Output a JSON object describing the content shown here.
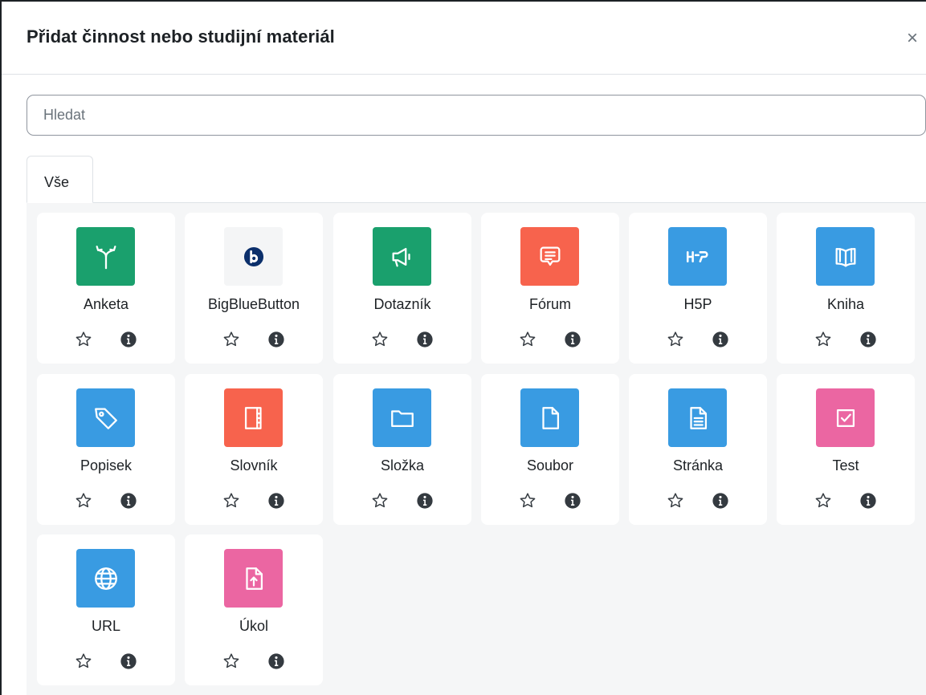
{
  "modal": {
    "title": "Přidat činnost nebo studijní materiál",
    "close_glyph": "×"
  },
  "search": {
    "placeholder": "Hledat",
    "value": ""
  },
  "tabs": [
    {
      "label": "Vše",
      "active": true
    }
  ],
  "colors": {
    "green": "#1aa06d",
    "blue": "#399be2",
    "orange": "#f7634d",
    "pink": "#eb66a2",
    "bbb_bg": "#f4f5f6",
    "bbb_logo": "#0b2f6b"
  },
  "activities": [
    {
      "label": "Anketa",
      "icon": "choice-icon",
      "color": "#1aa06d"
    },
    {
      "label": "BigBlueButton",
      "icon": "bigbluebutton-icon",
      "color": "#f4f5f6"
    },
    {
      "label": "Dotazník",
      "icon": "feedback-icon",
      "color": "#1aa06d"
    },
    {
      "label": "Fórum",
      "icon": "forum-icon",
      "color": "#f7634d"
    },
    {
      "label": "H5P",
      "icon": "h5p-icon",
      "color": "#399be2"
    },
    {
      "label": "Kniha",
      "icon": "book-icon",
      "color": "#399be2"
    },
    {
      "label": "Popisek",
      "icon": "label-icon",
      "color": "#399be2"
    },
    {
      "label": "Slovník",
      "icon": "glossary-icon",
      "color": "#f7634d"
    },
    {
      "label": "Složka",
      "icon": "folder-icon",
      "color": "#399be2"
    },
    {
      "label": "Soubor",
      "icon": "file-icon",
      "color": "#399be2"
    },
    {
      "label": "Stránka",
      "icon": "page-icon",
      "color": "#399be2"
    },
    {
      "label": "Test",
      "icon": "quiz-icon",
      "color": "#eb66a2"
    },
    {
      "label": "URL",
      "icon": "url-icon",
      "color": "#399be2"
    },
    {
      "label": "Úkol",
      "icon": "assignment-icon",
      "color": "#eb66a2"
    }
  ],
  "card_actions": {
    "star_icon": "star-icon",
    "info_icon": "info-icon"
  }
}
